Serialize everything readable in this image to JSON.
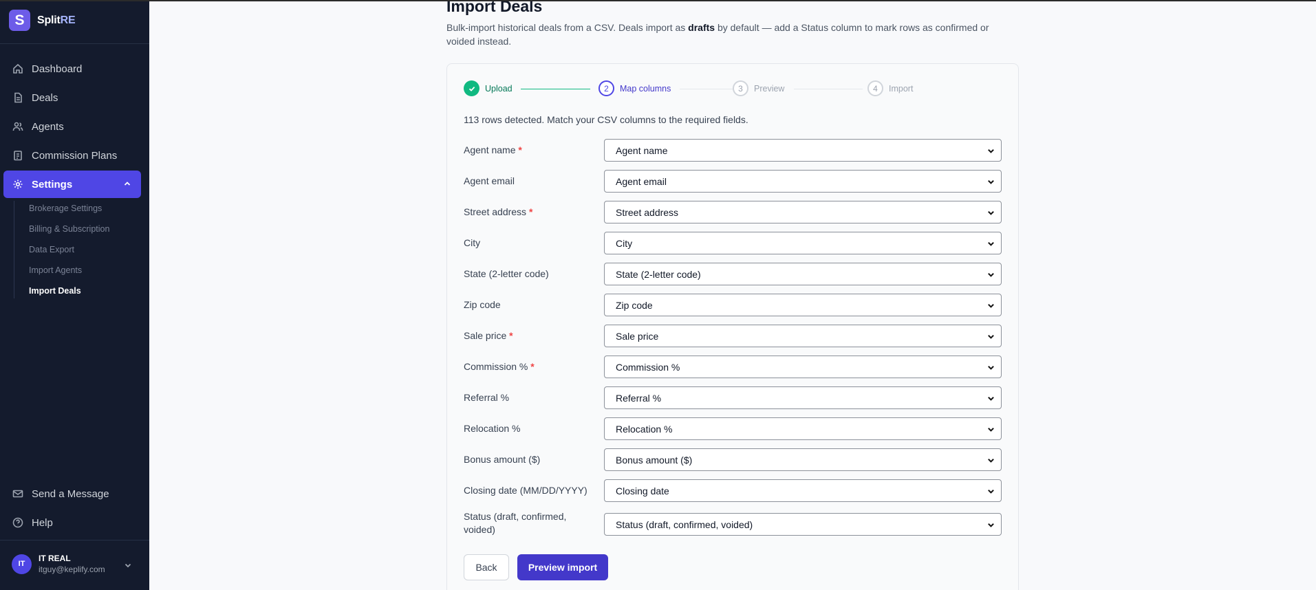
{
  "brand": {
    "letter": "S",
    "name_a": "Split",
    "name_b": "RE"
  },
  "nav": {
    "dashboard": "Dashboard",
    "deals": "Deals",
    "agents": "Agents",
    "commission_plans": "Commission Plans",
    "settings": "Settings",
    "send_message": "Send a Message",
    "help": "Help"
  },
  "subnav": {
    "brokerage": "Brokerage Settings",
    "billing": "Billing & Subscription",
    "data_export": "Data Export",
    "import_agents": "Import Agents",
    "import_deals": "Import Deals"
  },
  "user": {
    "initials": "IT",
    "name": "IT REAL",
    "email": "itguy@keplify.com"
  },
  "page": {
    "title": "Import Deals",
    "desc_a": "Bulk-import historical deals from a CSV. Deals import as ",
    "desc_bold": "drafts",
    "desc_b": " by default — add a Status column to mark rows as confirmed or voided instead."
  },
  "steps": [
    {
      "num": "",
      "label": "Upload"
    },
    {
      "num": "2",
      "label": "Map columns"
    },
    {
      "num": "3",
      "label": "Preview"
    },
    {
      "num": "4",
      "label": "Import"
    }
  ],
  "rows_note": "113 rows detected. Match your CSV columns to the required fields.",
  "fields": [
    {
      "label": "Agent name",
      "req": "*",
      "value": "Agent name"
    },
    {
      "label": "Agent email",
      "req": "",
      "value": "Agent email"
    },
    {
      "label": "Street address",
      "req": "*",
      "value": "Street address"
    },
    {
      "label": "City",
      "req": "",
      "value": "City"
    },
    {
      "label": "State (2-letter code)",
      "req": "",
      "value": "State (2-letter code)"
    },
    {
      "label": "Zip code",
      "req": "",
      "value": "Zip code"
    },
    {
      "label": "Sale price",
      "req": "*",
      "value": "Sale price"
    },
    {
      "label": "Commission %",
      "req": "*",
      "value": "Commission %"
    },
    {
      "label": "Referral %",
      "req": "",
      "value": "Referral %"
    },
    {
      "label": "Relocation %",
      "req": "",
      "value": "Relocation %"
    },
    {
      "label": "Bonus amount ($)",
      "req": "",
      "value": "Bonus amount ($)"
    },
    {
      "label": "Closing date (MM/DD/YYYY)",
      "req": "",
      "value": "Closing date"
    },
    {
      "label": "Status (draft, confirmed, voided)",
      "req": "",
      "value": "Status (draft, confirmed, voided)"
    }
  ],
  "buttons": {
    "back": "Back",
    "preview": "Preview import"
  },
  "colors": {
    "sidebar": "#141b2d",
    "accent": "#4f46e5",
    "success": "#10b981",
    "required": "#ef4444"
  }
}
